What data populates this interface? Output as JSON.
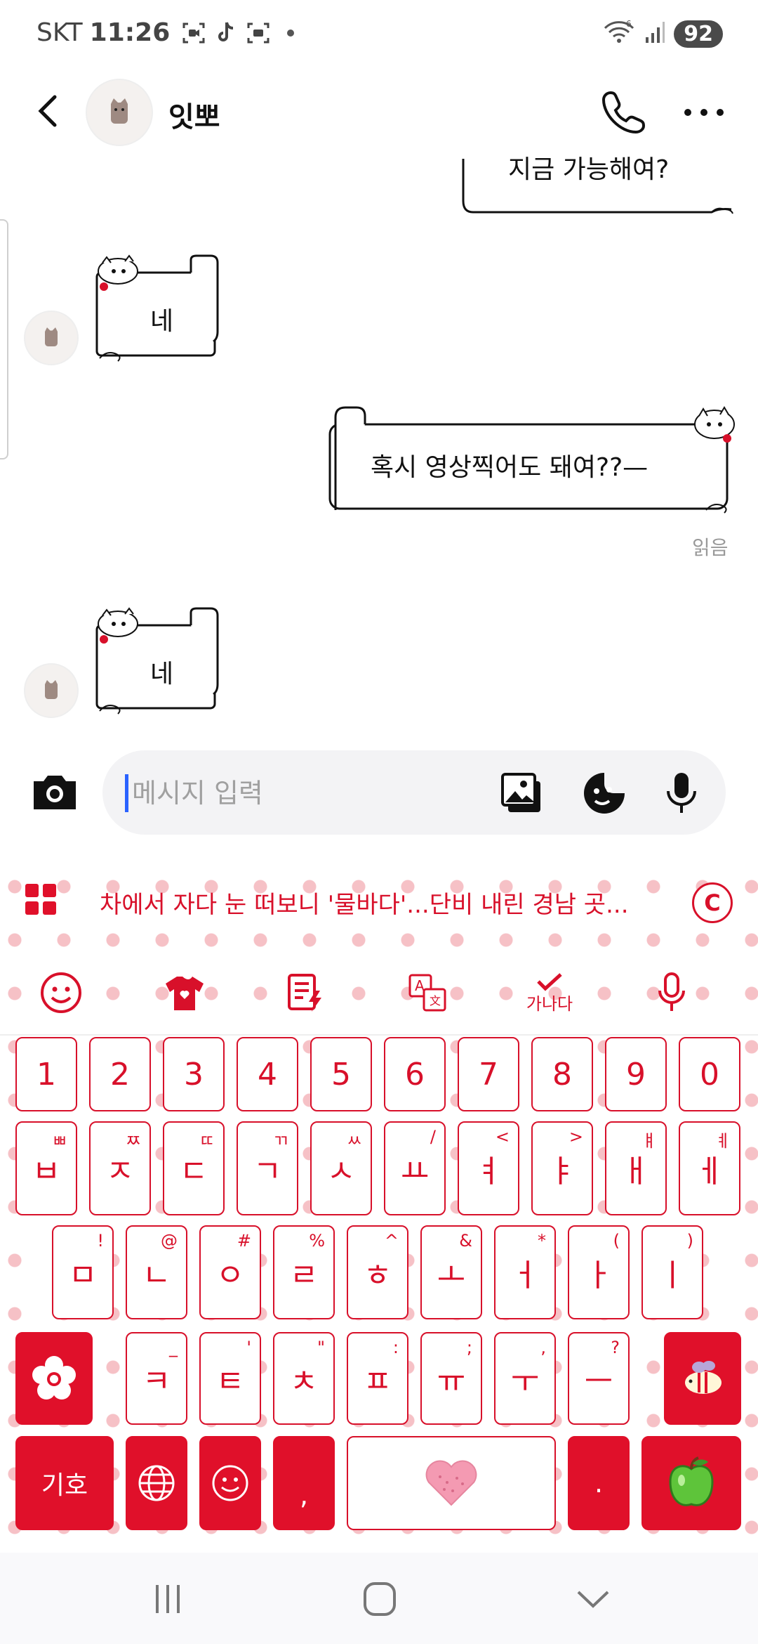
{
  "status_bar": {
    "carrier": "SKT",
    "time": "11:26",
    "battery": "92"
  },
  "header": {
    "contact_name": "잇뽀"
  },
  "messages": [
    {
      "side": "sent",
      "text": "지금 가능해여?"
    },
    {
      "side": "received",
      "text": "네"
    },
    {
      "side": "sent",
      "text": "혹시 영상찍어도 돼여??—",
      "read_label": "읽음"
    },
    {
      "side": "received",
      "text": "네"
    }
  ],
  "input": {
    "placeholder": "메시지 입력",
    "value": ""
  },
  "keyboard": {
    "news_banner": "차에서 자다 눈 떠보니 '물바다'...단비 내린 경남 곳...",
    "copyright_label": "C",
    "toolbar": {
      "handwriting_label": "가나다"
    },
    "number_row": [
      "1",
      "2",
      "3",
      "4",
      "5",
      "6",
      "7",
      "8",
      "9",
      "0"
    ],
    "row1": [
      {
        "main": "ㅂ",
        "sub": "ㅃ"
      },
      {
        "main": "ㅈ",
        "sub": "ㅉ"
      },
      {
        "main": "ㄷ",
        "sub": "ㄸ"
      },
      {
        "main": "ㄱ",
        "sub": "ㄲ"
      },
      {
        "main": "ㅅ",
        "sub": "ㅆ"
      },
      {
        "main": "ㅛ",
        "sub": "/"
      },
      {
        "main": "ㅕ",
        "sub": "<"
      },
      {
        "main": "ㅑ",
        "sub": ">"
      },
      {
        "main": "ㅐ",
        "sub": "ㅒ"
      },
      {
        "main": "ㅔ",
        "sub": "ㅖ"
      }
    ],
    "row2": [
      {
        "main": "ㅁ",
        "sub": "!"
      },
      {
        "main": "ㄴ",
        "sub": "@"
      },
      {
        "main": "ㅇ",
        "sub": "#"
      },
      {
        "main": "ㄹ",
        "sub": "%"
      },
      {
        "main": "ㅎ",
        "sub": "^"
      },
      {
        "main": "ㅗ",
        "sub": "&"
      },
      {
        "main": "ㅓ",
        "sub": "*"
      },
      {
        "main": "ㅏ",
        "sub": "("
      },
      {
        "main": "ㅣ",
        "sub": ")"
      }
    ],
    "row3": [
      {
        "main": "ㅋ",
        "sub": "_"
      },
      {
        "main": "ㅌ",
        "sub": "'"
      },
      {
        "main": "ㅊ",
        "sub": "\""
      },
      {
        "main": "ㅍ",
        "sub": ":"
      },
      {
        "main": "ㅠ",
        "sub": ";"
      },
      {
        "main": "ㅜ",
        "sub": ","
      },
      {
        "main": "ㅡ",
        "sub": "?"
      }
    ],
    "symbols_label": "기호",
    "comma_label": ",",
    "period_label": "."
  }
}
